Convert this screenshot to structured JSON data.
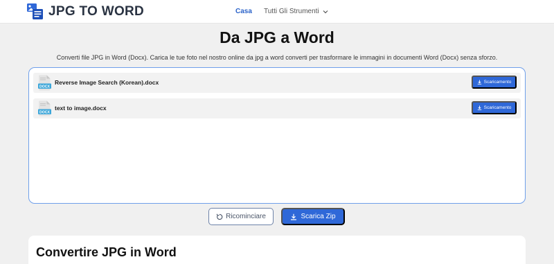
{
  "header": {
    "logo_text": "JPG TO WORD",
    "nav": {
      "home": "Casa",
      "tools": "Tutti Gli Strumenti"
    }
  },
  "main": {
    "title": "Da JPG a Word",
    "description": "Converti file JPG in Word (Docx). Carica le tue foto nel nostro online da jpg a word converti per trasformare le immagini in documenti Word (Docx) senza sforzo."
  },
  "files": [
    {
      "name": "Reverse Image Search (Korean).docx",
      "type_label": "DOCX",
      "download_label": "Scaricamento"
    },
    {
      "name": "text to image.docx",
      "type_label": "DOCX",
      "download_label": "Scaricamento"
    }
  ],
  "actions": {
    "restart_label": "Ricominciare",
    "zip_label": "Scarica Zip"
  },
  "info": {
    "title": "Convertire JPG in Word"
  },
  "colors": {
    "accent": "#2f68d8",
    "box_border": "#6f9fea",
    "background": "#f0f0f0"
  },
  "icons": {
    "logo": "jpg-to-word-logo-icon",
    "dropdown": "chevron-down-icon",
    "file": "docx-file-icon",
    "download": "download-icon",
    "restart": "restart-icon"
  }
}
